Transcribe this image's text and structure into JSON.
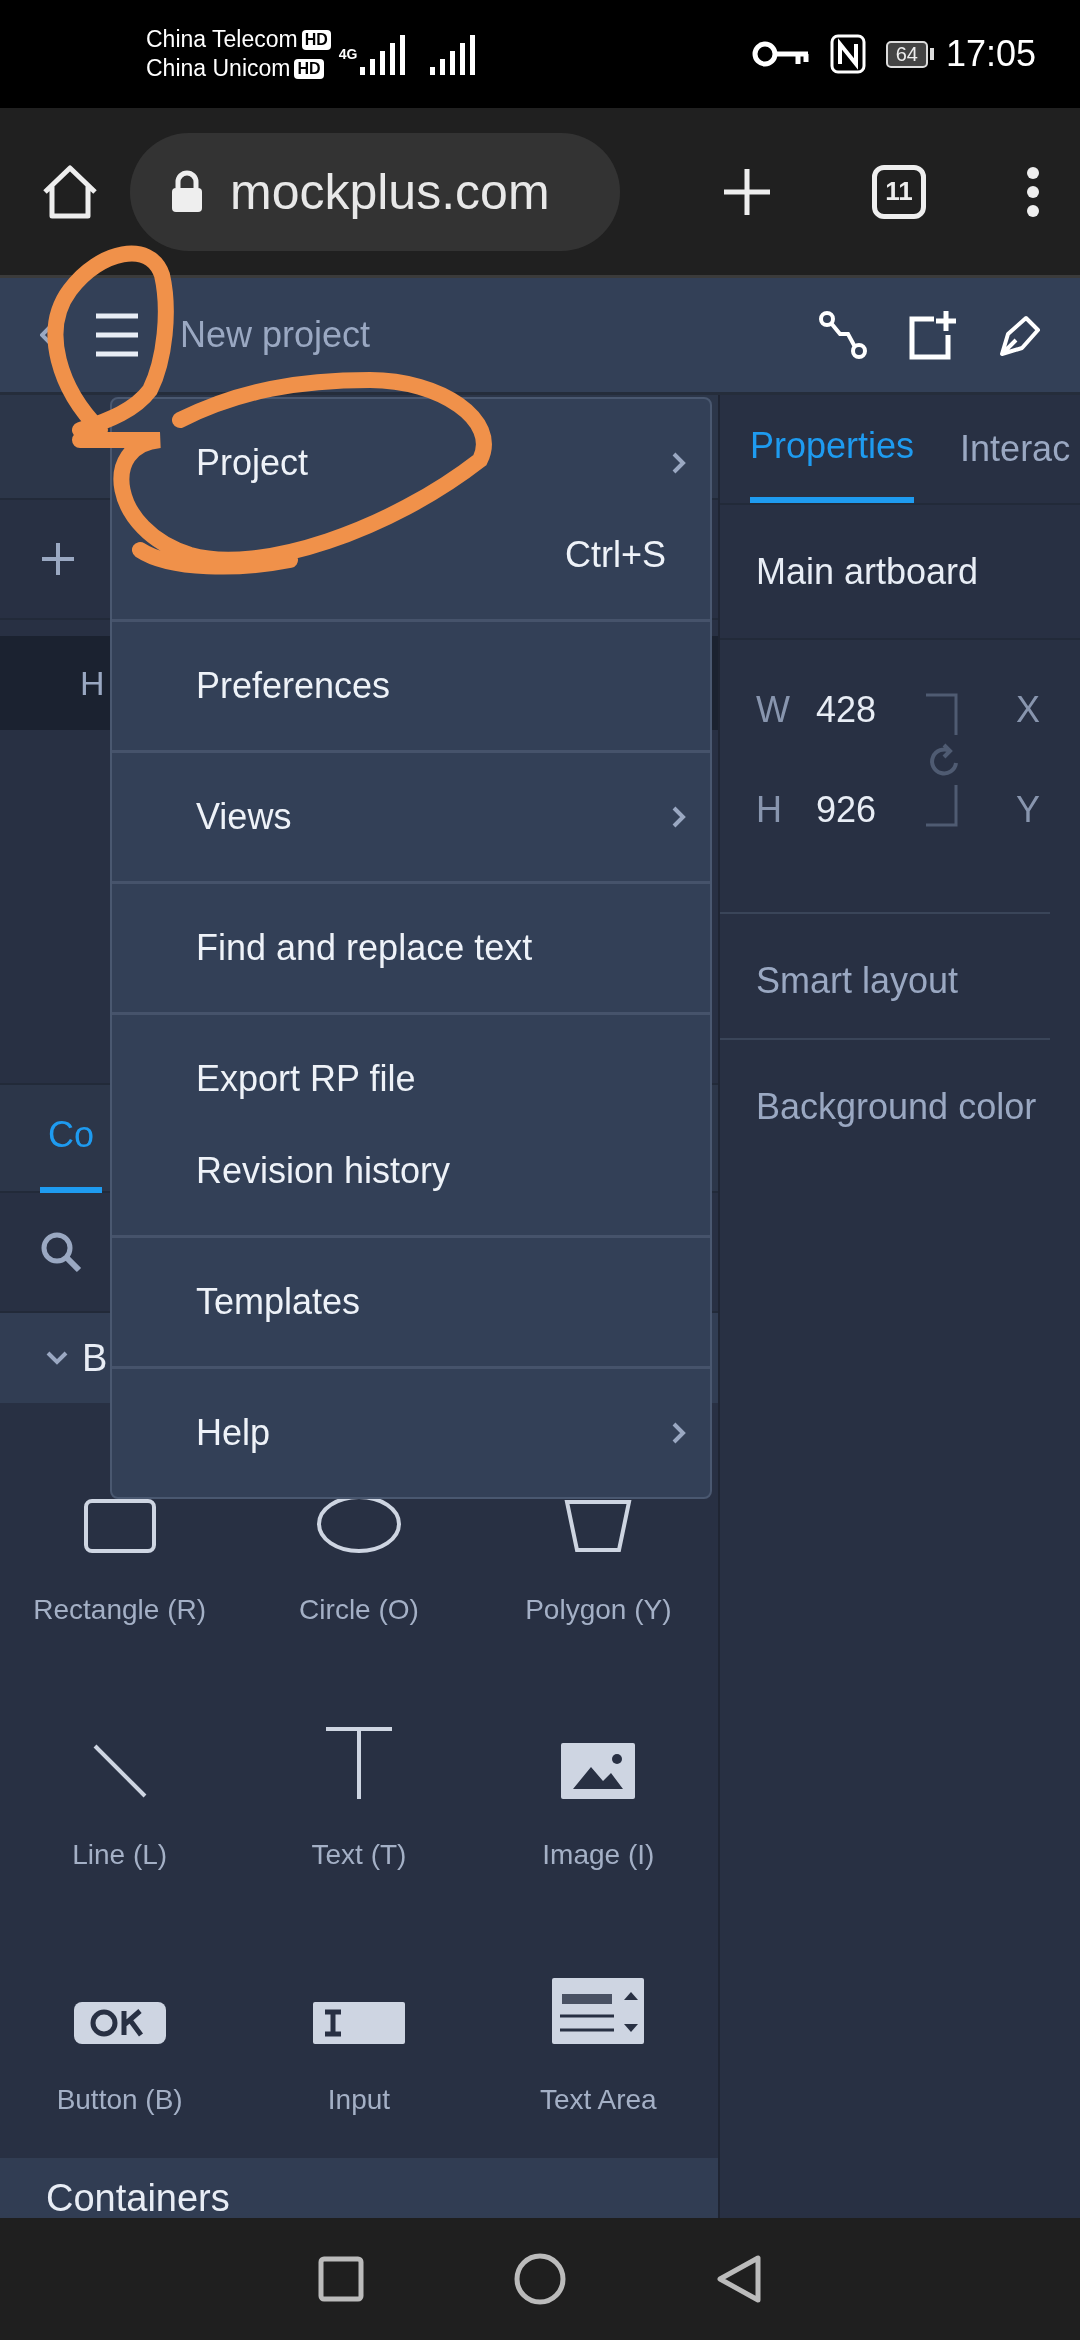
{
  "status_bar": {
    "carriers": [
      {
        "name": "China Telecom",
        "badge": "HD"
      },
      {
        "name": "China Unicom",
        "badge": "HD"
      }
    ],
    "network": "4G",
    "battery": "64",
    "time": "17:05"
  },
  "browser": {
    "url": "mockplus.com",
    "tab_count": "11"
  },
  "app_header": {
    "title": "New project"
  },
  "left_panel": {
    "layer_item": "H",
    "tabs": [
      {
        "label": "Co",
        "selected": true
      }
    ],
    "section": "B",
    "components": [
      {
        "label": "Rectangle (R)",
        "kind": "rectangle"
      },
      {
        "label": "Circle (O)",
        "kind": "circle"
      },
      {
        "label": "Polygon (Y)",
        "kind": "polygon"
      },
      {
        "label": "Line (L)",
        "kind": "line"
      },
      {
        "label": "Text (T)",
        "kind": "text"
      },
      {
        "label": "Image (I)",
        "kind": "image"
      },
      {
        "label": "Button (B)",
        "kind": "button"
      },
      {
        "label": "Input",
        "kind": "input"
      },
      {
        "label": "Text Area",
        "kind": "textarea"
      }
    ],
    "next_section": "Containers"
  },
  "right_panel": {
    "tabs": [
      {
        "label": "Properties",
        "selected": true
      },
      {
        "label": "Interac",
        "selected": false
      }
    ],
    "artboard": "Main artboard",
    "fields": [
      {
        "label": "W",
        "value": "428",
        "pair": "X"
      },
      {
        "label": "H",
        "value": "926",
        "pair": "Y"
      }
    ],
    "sections": [
      "Smart layout",
      "Background color"
    ]
  },
  "menu": {
    "groups": [
      [
        {
          "label": "Project",
          "submenu": true
        },
        {
          "shortcut": "Ctrl+S",
          "submenu": false
        }
      ],
      [
        {
          "label": "Preferences",
          "submenu": false
        }
      ],
      [
        {
          "label": "Views",
          "submenu": true
        }
      ],
      [
        {
          "label": "Find and replace text",
          "submenu": false
        }
      ],
      [
        {
          "label": "Export RP file",
          "submenu": false
        },
        {
          "label": "Revision history",
          "submenu": false
        }
      ],
      [
        {
          "label": "Templates",
          "submenu": false
        }
      ],
      [
        {
          "label": "Help",
          "submenu": true
        }
      ]
    ]
  }
}
